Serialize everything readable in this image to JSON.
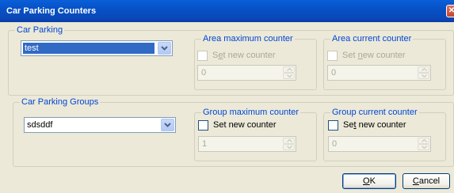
{
  "window": {
    "title": "Car Parking Counters",
    "close_glyph": "✕"
  },
  "car_parking": {
    "legend": "Car Parking",
    "selected": "test",
    "area_max": {
      "legend": "Area maximum counter",
      "checkbox_pre": "S",
      "checkbox_u": "e",
      "checkbox_post": "t new counter",
      "value": "0",
      "checked": false,
      "enabled": false
    },
    "area_current": {
      "legend": "Area current counter",
      "checkbox_pre": "Set ",
      "checkbox_u": "n",
      "checkbox_post": "ew counter",
      "value": "0",
      "checked": false,
      "enabled": false
    }
  },
  "car_parking_groups": {
    "legend": "Car Parking Groups",
    "selected": "sdsddf",
    "group_max": {
      "legend": "Group maximum counter",
      "checkbox_label": "Set new counter",
      "value": "1",
      "checked": false,
      "enabled": true
    },
    "group_current": {
      "legend": "Group current counter",
      "checkbox_pre": "Se",
      "checkbox_u": "t",
      "checkbox_post": " new counter",
      "value": "0",
      "checked": false,
      "enabled": true
    }
  },
  "buttons": {
    "ok_u": "O",
    "ok_post": "K",
    "cancel_u": "C",
    "cancel_post": "ancel"
  },
  "colors": {
    "title_bar": "#0a5fd8",
    "legend_text": "#0046d5",
    "selection": "#316ac5"
  }
}
